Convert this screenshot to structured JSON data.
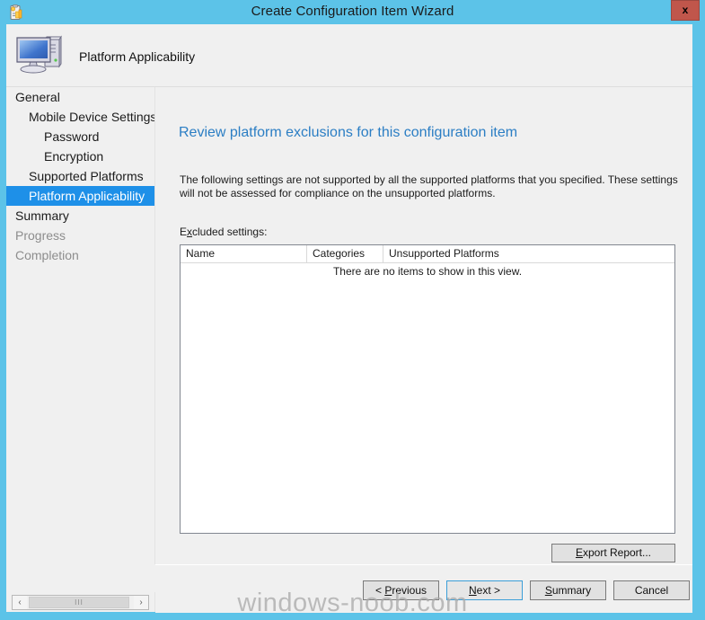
{
  "window": {
    "title": "Create Configuration Item Wizard",
    "title_icon": "configuration-item-icon",
    "close_label": "x",
    "titlebar_color": "#5cc3e8",
    "close_color": "#c0564b"
  },
  "header": {
    "icon": "computer-icon",
    "title": "Platform Applicability"
  },
  "sidebar": {
    "items": [
      {
        "label": "General",
        "level": 1,
        "selected": false,
        "disabled": false
      },
      {
        "label": "Mobile Device Settings",
        "level": 2,
        "selected": false,
        "disabled": false
      },
      {
        "label": "Password",
        "level": 3,
        "selected": false,
        "disabled": false
      },
      {
        "label": "Encryption",
        "level": 3,
        "selected": false,
        "disabled": false
      },
      {
        "label": "Supported Platforms",
        "level": 2,
        "selected": false,
        "disabled": false
      },
      {
        "label": "Platform Applicability",
        "level": 2,
        "selected": true,
        "disabled": false
      },
      {
        "label": "Summary",
        "level": 1,
        "selected": false,
        "disabled": false
      },
      {
        "label": "Progress",
        "level": 1,
        "selected": false,
        "disabled": true
      },
      {
        "label": "Completion",
        "level": 1,
        "selected": false,
        "disabled": true
      }
    ],
    "selection_color": "#1e90e8",
    "scrollbar": {
      "left_arrow": "‹",
      "right_arrow": "›",
      "thumb_grip": "III"
    }
  },
  "content": {
    "heading": "Review platform exclusions for this configuration item",
    "body_text": "The following settings are not supported by all the supported platforms that you specified. These settings will not be assessed for compliance on the unsupported platforms.",
    "excluded_label_prefix": "E",
    "excluded_label_accel": "x",
    "excluded_label_suffix": "cluded settings:",
    "listview": {
      "columns": [
        "Name",
        "Categories",
        "Unsupported Platforms"
      ],
      "rows": [],
      "empty_text": "There are no items to show in this view."
    },
    "export_report": {
      "accel": "E",
      "rest": "xport Report..."
    }
  },
  "footer": {
    "buttons": [
      {
        "prefix": "< ",
        "accel": "P",
        "rest": "revious"
      },
      {
        "prefix": "",
        "accel": "N",
        "rest": "ext >"
      },
      {
        "prefix": "",
        "accel": "S",
        "rest": "ummary"
      },
      {
        "prefix": "",
        "accel": "",
        "rest": "Cancel"
      }
    ],
    "default_button_index": 1
  },
  "watermark": {
    "text": "windows-noob.com"
  }
}
